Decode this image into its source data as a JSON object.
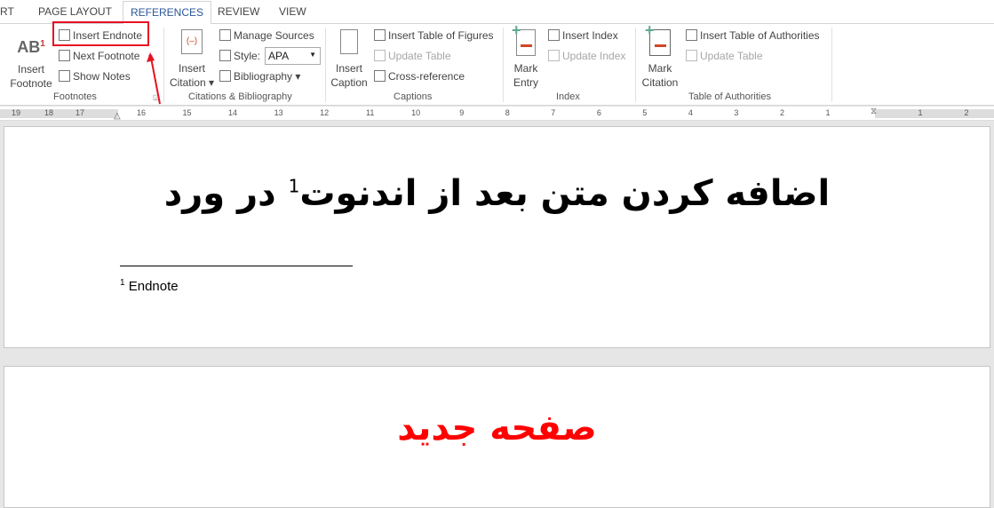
{
  "tabs": [
    {
      "label": "RT"
    },
    {
      "label": "PAGE LAYOUT"
    },
    {
      "label": "REFERENCES"
    },
    {
      "label": "REVIEW"
    },
    {
      "label": "VIEW"
    }
  ],
  "footnotes": {
    "insert_footnote": "Insert Footnote",
    "insert_footnote_l1": "Insert",
    "insert_footnote_l2": "Footnote",
    "insert_endnote": "Insert Endnote",
    "next_footnote": "Next Footnote",
    "show_notes": "Show Notes",
    "group": "Footnotes",
    "icon_text": "AB",
    "icon_sup": "1"
  },
  "citations": {
    "insert_l1": "Insert",
    "insert_l2": "Citation",
    "manage_sources": "Manage Sources",
    "style_label": "Style:",
    "style_value": "APA",
    "bibliography": "Bibliography",
    "group": "Citations & Bibliography"
  },
  "captions": {
    "insert_l1": "Insert",
    "insert_l2": "Caption",
    "table_of_figures": "Insert Table of Figures",
    "update_table": "Update Table",
    "cross_reference": "Cross-reference",
    "group": "Captions"
  },
  "index": {
    "mark_l1": "Mark",
    "mark_l2": "Entry",
    "insert_index": "Insert Index",
    "update_index": "Update Index",
    "group": "Index"
  },
  "authorities": {
    "mark_l1": "Mark",
    "mark_l2": "Citation",
    "insert_toa": "Insert Table of Authorities",
    "update_table": "Update Table",
    "group": "Table of Authorities"
  },
  "ruler": {
    "numbers": [
      "19",
      "18",
      "17",
      "16",
      "15",
      "14",
      "13",
      "12",
      "11",
      "10",
      "9",
      "8",
      "7",
      "6",
      "5",
      "4",
      "3",
      "2",
      "1",
      "1",
      "2"
    ]
  },
  "document": {
    "title_before": "اضافه کردن متن بعد از اندنوت",
    "title_sup": "1",
    "title_after": " در ورد",
    "endnote_num": "1",
    "endnote_text": "Endnote",
    "page2_title": "صفحه جدید"
  },
  "colors": {
    "accent": "#2b579a",
    "highlight": "#e81123",
    "page2_title": "#ff0000"
  }
}
